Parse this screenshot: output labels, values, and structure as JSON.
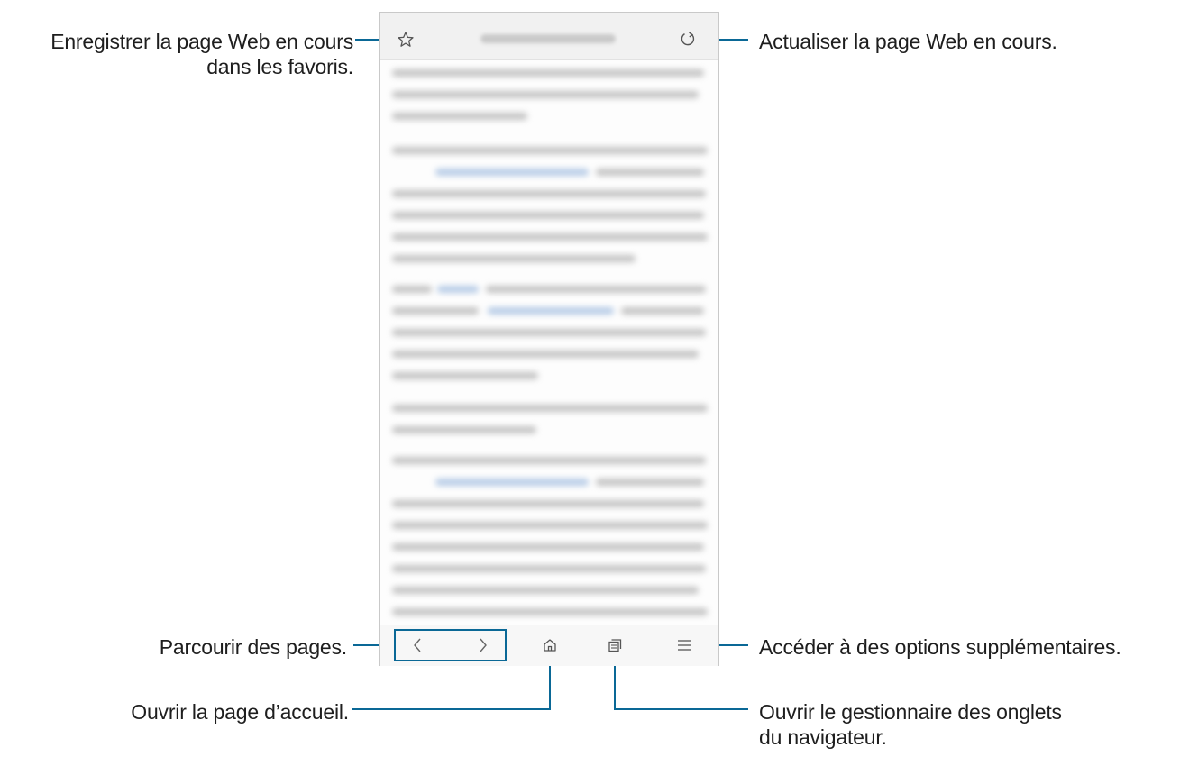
{
  "callouts": {
    "bookmark": {
      "line1": "Enregistrer la page Web en cours",
      "line2": "dans les favoris."
    },
    "refresh": "Actualiser la page Web en cours.",
    "browse": "Parcourir des pages.",
    "more": "Accéder à des options supplémentaires.",
    "home": "Ouvrir la page d’accueil.",
    "tabs": {
      "line1": "Ouvrir le gestionnaire des onglets",
      "line2": "du navigateur."
    }
  },
  "icons": {
    "top_left": "star-outline-icon",
    "top_right": "refresh-icon",
    "bottom": [
      "chevron-left-icon",
      "chevron-right-icon",
      "home-icon",
      "tabs-icon",
      "menu-icon"
    ]
  },
  "colors": {
    "callout_line": "#0a6896",
    "text": "#1e1e1e"
  }
}
